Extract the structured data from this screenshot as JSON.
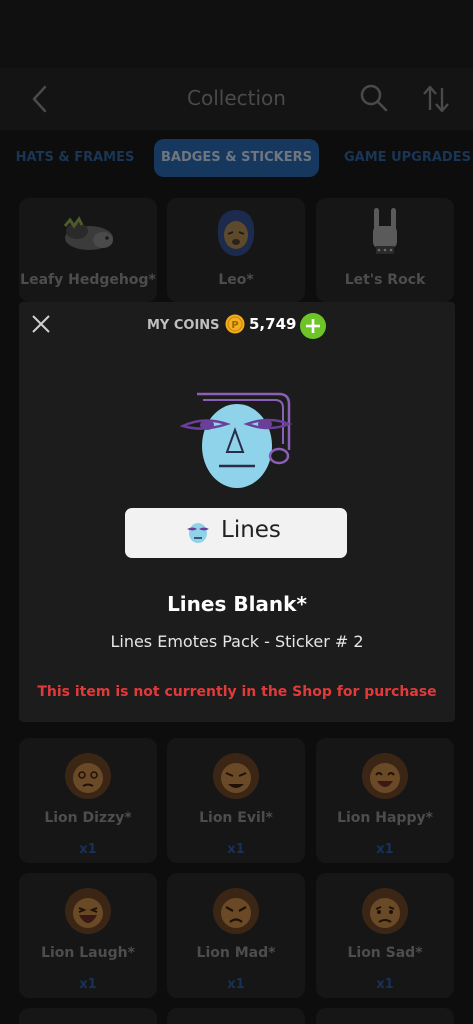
{
  "header": {
    "title": "Collection",
    "back_icon": "chevron-left-icon",
    "search_icon": "search-icon",
    "sort_icon": "sort-icon"
  },
  "tabs": [
    {
      "label": "HATS & FRAMES",
      "active": false
    },
    {
      "label": "BADGES & STICKERS",
      "active": true
    },
    {
      "label": "GAME UPGRADES",
      "active": false
    }
  ],
  "top_row": [
    {
      "name": "Leafy Hedgehog*",
      "icon": "hedgehog-icon"
    },
    {
      "name": "Leo*",
      "icon": "lion-head-icon"
    },
    {
      "name": "Let's Rock",
      "icon": "rock-hand-icon"
    }
  ],
  "grid_rows": [
    [
      {
        "name": "Lion Dizzy*",
        "qty": "x1",
        "icon": "lion-dizzy-icon"
      },
      {
        "name": "Lion Evil*",
        "qty": "x1",
        "icon": "lion-evil-icon"
      },
      {
        "name": "Lion Happy*",
        "qty": "x1",
        "icon": "lion-happy-icon"
      }
    ],
    [
      {
        "name": "Lion Laugh*",
        "qty": "x1",
        "icon": "lion-laugh-icon"
      },
      {
        "name": "Lion Mad*",
        "qty": "x1",
        "icon": "lion-mad-icon"
      },
      {
        "name": "Lion Sad*",
        "qty": "x1",
        "icon": "lion-sad-icon"
      }
    ]
  ],
  "modal": {
    "coins_label": "MY COINS",
    "coins_value": "5,749",
    "pack_badge_label": "Lines",
    "item_name": "Lines Blank*",
    "item_subtitle": "Lines Emotes Pack - Sticker # 2",
    "shop_notice": "This item is not currently in the Shop for purchase",
    "close_icon": "close-icon",
    "coin_icon": "coin-icon",
    "add_icon": "plus-circle-icon"
  },
  "colors": {
    "accent_blue": "#17385e",
    "notice_red": "#e03a3a",
    "coin_gold": "#f2b01e",
    "add_green": "#6dc427"
  }
}
